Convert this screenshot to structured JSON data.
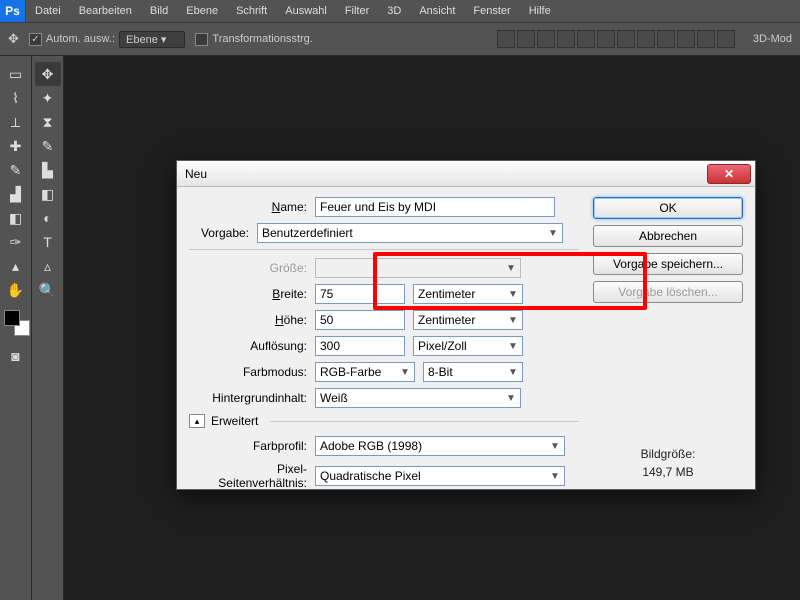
{
  "menubar": {
    "logo": "Ps",
    "items": [
      "Datei",
      "Bearbeiten",
      "Bild",
      "Ebene",
      "Schrift",
      "Auswahl",
      "Filter",
      "3D",
      "Ansicht",
      "Fenster",
      "Hilfe"
    ]
  },
  "optionsbar": {
    "auto_select_label": "Autom. ausw.:",
    "auto_select_target": "Ebene",
    "transform_controls_label": "Transformationsstrg.",
    "mode3d_label": "3D-Mod"
  },
  "dialog": {
    "title": "Neu",
    "name_label": "Name:",
    "name_value": "Feuer und Eis by MDI",
    "preset_label": "Vorgabe:",
    "preset_value": "Benutzerdefiniert",
    "size_label": "Größe:",
    "size_value": "",
    "width_label": "Breite:",
    "width_value": "75",
    "width_unit": "Zentimeter",
    "height_label": "Höhe:",
    "height_value": "50",
    "height_unit": "Zentimeter",
    "resolution_label": "Auflösung:",
    "resolution_value": "300",
    "resolution_unit": "Pixel/Zoll",
    "colormode_label": "Farbmodus:",
    "colormode_value": "RGB-Farbe",
    "colordepth_value": "8-Bit",
    "bgcontent_label": "Hintergrundinhalt:",
    "bgcontent_value": "Weiß",
    "advanced_label": "Erweitert",
    "colorprofile_label": "Farbprofil:",
    "colorprofile_value": "Adobe RGB (1998)",
    "pixelaspect_label": "Pixel-Seitenverhältnis:",
    "pixelaspect_value": "Quadratische Pixel",
    "imagesize_label": "Bildgröße:",
    "imagesize_value": "149,7 MB",
    "buttons": {
      "ok": "OK",
      "cancel": "Abbrechen",
      "save_preset": "Vorgabe speichern...",
      "delete_preset": "Vorgabe löschen..."
    }
  },
  "tools_left": [
    "marquee",
    "lasso",
    "crop",
    "patch",
    "brush-large",
    "clone",
    "eraser",
    "pen",
    "path-select",
    "hand"
  ],
  "tools_right": [
    "move",
    "wand",
    "eyedropper",
    "brush",
    "stamp",
    "gradient",
    "dodge",
    "type",
    "direct-select",
    "zoom"
  ]
}
